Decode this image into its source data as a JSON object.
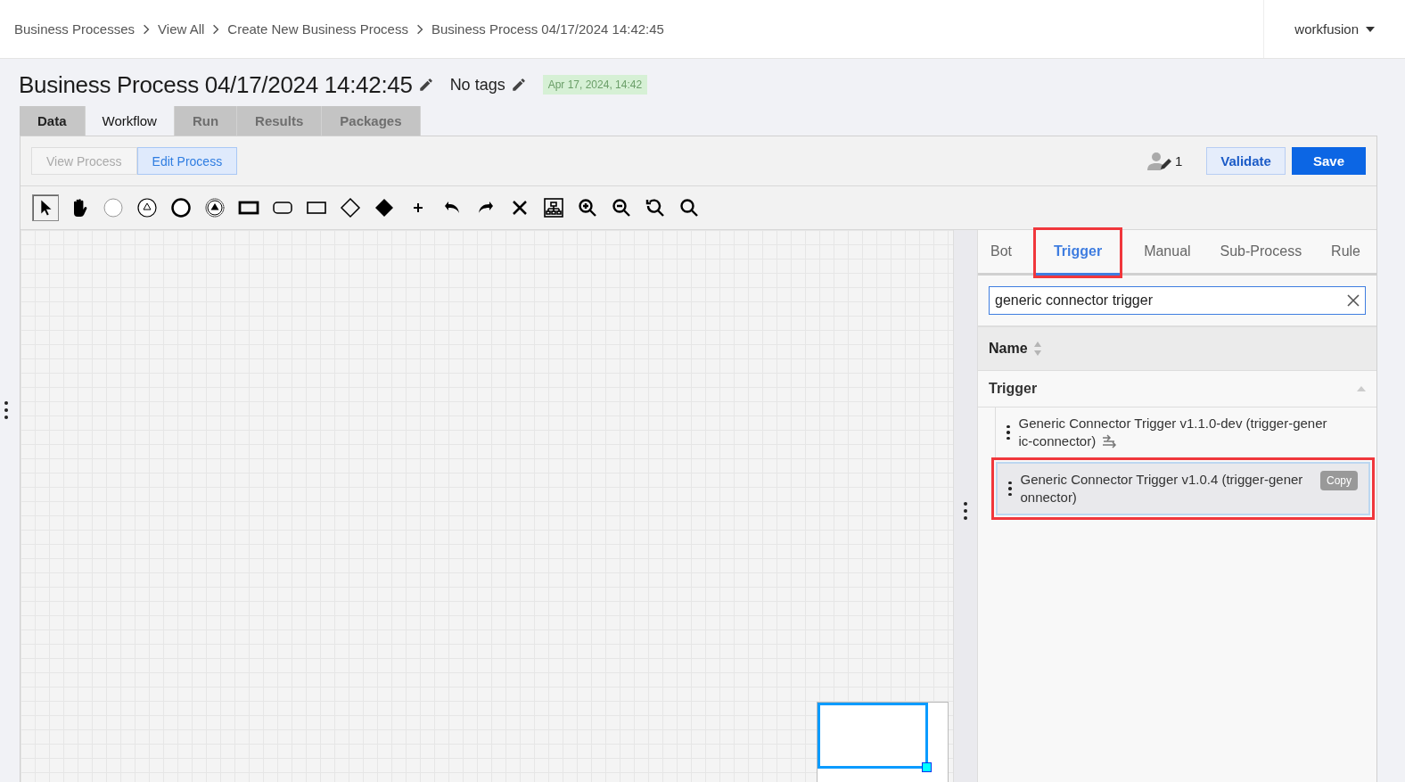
{
  "breadcrumbs": [
    "Business Processes",
    "View All",
    "Create New Business Process",
    "Business Process 04/17/2024 14:42:45"
  ],
  "user_menu": {
    "label": "workfusion"
  },
  "title": "Business Process 04/17/2024 14:42:45",
  "tags": "No tags",
  "timestamp": "Apr 17, 2024, 14:42",
  "tabs": [
    {
      "label": "Data",
      "selected": false,
      "disabled": false
    },
    {
      "label": "Workflow",
      "selected": true,
      "disabled": false
    },
    {
      "label": "Run",
      "selected": false,
      "disabled": true
    },
    {
      "label": "Results",
      "selected": false,
      "disabled": true
    },
    {
      "label": "Packages",
      "selected": false,
      "disabled": true
    }
  ],
  "mode_toggle": [
    {
      "label": "View Process",
      "selected": false
    },
    {
      "label": "Edit Process",
      "selected": true
    }
  ],
  "editors_count": "1",
  "buttons": [
    {
      "label": "Validate",
      "kind": "secondary"
    },
    {
      "label": "Save",
      "kind": "primary"
    }
  ],
  "tools": [
    {
      "kind": "pointer",
      "selected": true
    },
    {
      "kind": "hand",
      "selected": false
    },
    {
      "kind": "circle-thin",
      "selected": false
    },
    {
      "kind": "circle-triangle",
      "selected": false
    },
    {
      "kind": "circle-thick",
      "selected": false
    },
    {
      "kind": "circle-triangle-filled",
      "selected": false
    },
    {
      "kind": "rect-thick",
      "selected": false
    },
    {
      "kind": "rounded-rect",
      "selected": false
    },
    {
      "kind": "rect",
      "selected": false
    },
    {
      "kind": "diamond",
      "selected": false
    },
    {
      "kind": "diamond-filled",
      "selected": false
    },
    {
      "kind": "plus",
      "selected": false
    },
    {
      "kind": "undo",
      "selected": false
    },
    {
      "kind": "redo",
      "selected": false
    },
    {
      "kind": "close",
      "selected": false
    },
    {
      "kind": "layout",
      "selected": false
    },
    {
      "kind": "zoom-in",
      "selected": false
    },
    {
      "kind": "zoom-out",
      "selected": false
    },
    {
      "kind": "zoom-reset",
      "selected": false
    },
    {
      "kind": "zoom",
      "selected": false
    }
  ],
  "palette_tabs": [
    {
      "label": "Bot",
      "selected": false,
      "highlighted": false
    },
    {
      "label": "Trigger",
      "selected": true,
      "highlighted": true
    },
    {
      "label": "Manual",
      "selected": false,
      "highlighted": false
    },
    {
      "label": "Sub-Process",
      "selected": false,
      "highlighted": false
    },
    {
      "label": "Rule",
      "selected": false,
      "highlighted": false
    }
  ],
  "search": {
    "value": "generic connector trigger"
  },
  "column_header": "Name",
  "group": {
    "label": "Trigger",
    "expanded": true,
    "items": [
      {
        "lines": [
          "Generic Connector Trigger v1.1.0-dev (trigger-gener",
          "ic-connector)"
        ],
        "selected": false,
        "highlighted": false,
        "has_connector_icon": true
      },
      {
        "lines": [
          "Generic Connector Trigger v1.0.4 (trigger-gener",
          "onnector)"
        ],
        "selected": true,
        "highlighted": true,
        "has_connector_icon": false,
        "badge": "Copy"
      }
    ]
  }
}
